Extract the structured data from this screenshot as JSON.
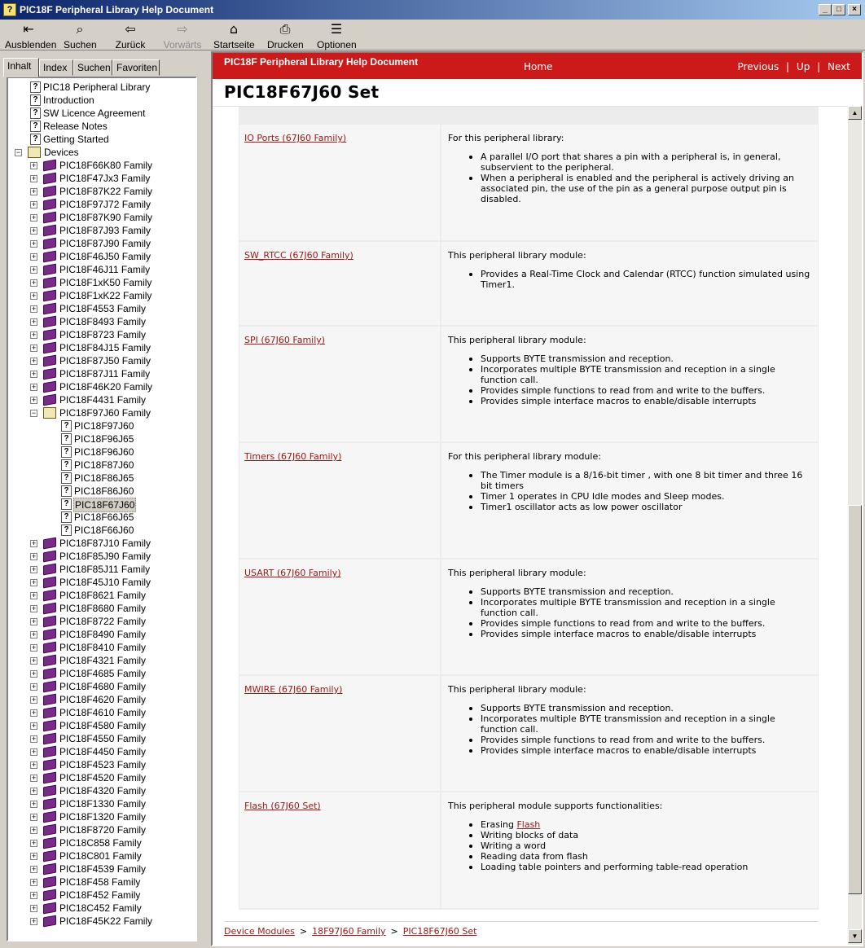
{
  "window": {
    "title": "PIC18F Peripheral Library Help Document"
  },
  "toolbar": [
    {
      "label": "Ausblenden",
      "icon": "hide-icon",
      "glyph": "⇤",
      "enabled": true
    },
    {
      "label": "Suchen",
      "icon": "search-icon",
      "glyph": "⌕",
      "enabled": true
    },
    {
      "label": "Zurück",
      "icon": "back-arrow-icon",
      "glyph": "⇦",
      "enabled": true
    },
    {
      "label": "Vorwärts",
      "icon": "forward-arrow-icon",
      "glyph": "⇨",
      "enabled": false
    },
    {
      "label": "Startseite",
      "icon": "home-icon",
      "glyph": "⌂",
      "enabled": true
    },
    {
      "label": "Drucken",
      "icon": "print-icon",
      "glyph": "⎙",
      "enabled": true
    },
    {
      "label": "Optionen",
      "icon": "options-icon",
      "glyph": "☰",
      "enabled": true
    }
  ],
  "tabs": [
    "Inhalt",
    "Index",
    "Suchen",
    "Favoriten"
  ],
  "tree": [
    {
      "label": "PIC18 Peripheral Library",
      "icon": "help-page",
      "level": 1
    },
    {
      "label": "Introduction",
      "icon": "help-page",
      "level": 1
    },
    {
      "label": "SW Licence Agreement",
      "icon": "help-page",
      "level": 1
    },
    {
      "label": "Release Notes",
      "icon": "help-page",
      "level": 1
    },
    {
      "label": "Getting Started",
      "icon": "help-page",
      "level": 1
    },
    {
      "label": "Devices",
      "icon": "open-book",
      "level": 0,
      "expander": "−"
    },
    {
      "label": "PIC18F66K80 Family",
      "icon": "book",
      "level": 1,
      "expander": "+"
    },
    {
      "label": "PIC18F47Jx3 Family",
      "icon": "book",
      "level": 1,
      "expander": "+"
    },
    {
      "label": "PIC18F87K22 Family",
      "icon": "book",
      "level": 1,
      "expander": "+"
    },
    {
      "label": "PIC18F97J72 Family",
      "icon": "book",
      "level": 1,
      "expander": "+"
    },
    {
      "label": "PIC18F87K90 Family",
      "icon": "book",
      "level": 1,
      "expander": "+"
    },
    {
      "label": "PIC18F87J93 Family",
      "icon": "book",
      "level": 1,
      "expander": "+"
    },
    {
      "label": "PIC18F87J90 Family",
      "icon": "book",
      "level": 1,
      "expander": "+"
    },
    {
      "label": "PIC18F46J50 Family",
      "icon": "book",
      "level": 1,
      "expander": "+"
    },
    {
      "label": "PIC18F46J11 Family",
      "icon": "book",
      "level": 1,
      "expander": "+"
    },
    {
      "label": "PIC18F1xK50 Family",
      "icon": "book",
      "level": 1,
      "expander": "+"
    },
    {
      "label": "PIC18F1xK22 Family",
      "icon": "book",
      "level": 1,
      "expander": "+"
    },
    {
      "label": "PIC18F4553 Family",
      "icon": "book",
      "level": 1,
      "expander": "+"
    },
    {
      "label": "PIC18F8493 Family",
      "icon": "book",
      "level": 1,
      "expander": "+"
    },
    {
      "label": "PIC18F8723 Family",
      "icon": "book",
      "level": 1,
      "expander": "+"
    },
    {
      "label": "PIC18F84J15 Family",
      "icon": "book",
      "level": 1,
      "expander": "+"
    },
    {
      "label": "PIC18F87J50 Family",
      "icon": "book",
      "level": 1,
      "expander": "+"
    },
    {
      "label": "PIC18F87J11 Family",
      "icon": "book",
      "level": 1,
      "expander": "+"
    },
    {
      "label": "PIC18F46K20 Family",
      "icon": "book",
      "level": 1,
      "expander": "+"
    },
    {
      "label": "PIC18F4431 Family",
      "icon": "book",
      "level": 1,
      "expander": "+"
    },
    {
      "label": "PIC18F97J60 Family",
      "icon": "open-book",
      "level": 1,
      "expander": "−"
    },
    {
      "label": "PIC18F97J60",
      "icon": "help-page",
      "level": 2
    },
    {
      "label": "PIC18F96J65",
      "icon": "help-page",
      "level": 2
    },
    {
      "label": "PIC18F96J60",
      "icon": "help-page",
      "level": 2
    },
    {
      "label": "PIC18F87J60",
      "icon": "help-page",
      "level": 2
    },
    {
      "label": "PIC18F86J65",
      "icon": "help-page",
      "level": 2
    },
    {
      "label": "PIC18F86J60",
      "icon": "help-page",
      "level": 2
    },
    {
      "label": "PIC18F67J60",
      "icon": "help-page",
      "level": 2,
      "selected": true
    },
    {
      "label": "PIC18F66J65",
      "icon": "help-page",
      "level": 2
    },
    {
      "label": "PIC18F66J60",
      "icon": "help-page",
      "level": 2
    },
    {
      "label": "PIC18F87J10 Family",
      "icon": "book",
      "level": 1,
      "expander": "+"
    },
    {
      "label": "PIC18F85J90 Family",
      "icon": "book",
      "level": 1,
      "expander": "+"
    },
    {
      "label": "PIC18F85J11 Family",
      "icon": "book",
      "level": 1,
      "expander": "+"
    },
    {
      "label": "PIC18F45J10 Family",
      "icon": "book",
      "level": 1,
      "expander": "+"
    },
    {
      "label": "PIC18F8621 Family",
      "icon": "book",
      "level": 1,
      "expander": "+"
    },
    {
      "label": "PIC18F8680 Family",
      "icon": "book",
      "level": 1,
      "expander": "+"
    },
    {
      "label": "PIC18F8722 Family",
      "icon": "book",
      "level": 1,
      "expander": "+"
    },
    {
      "label": "PIC18F8490 Family",
      "icon": "book",
      "level": 1,
      "expander": "+"
    },
    {
      "label": "PIC18F8410 Family",
      "icon": "book",
      "level": 1,
      "expander": "+"
    },
    {
      "label": "PIC18F4321 Family",
      "icon": "book",
      "level": 1,
      "expander": "+"
    },
    {
      "label": "PIC18F4685 Family",
      "icon": "book",
      "level": 1,
      "expander": "+"
    },
    {
      "label": "PIC18F4680 Family",
      "icon": "book",
      "level": 1,
      "expander": "+"
    },
    {
      "label": "PIC18F4620 Family",
      "icon": "book",
      "level": 1,
      "expander": "+"
    },
    {
      "label": "PIC18F4610 Family",
      "icon": "book",
      "level": 1,
      "expander": "+"
    },
    {
      "label": "PIC18F4580 Family",
      "icon": "book",
      "level": 1,
      "expander": "+"
    },
    {
      "label": "PIC18F4550 Family",
      "icon": "book",
      "level": 1,
      "expander": "+"
    },
    {
      "label": "PIC18F4450 Family",
      "icon": "book",
      "level": 1,
      "expander": "+"
    },
    {
      "label": "PIC18F4523 Family",
      "icon": "book",
      "level": 1,
      "expander": "+"
    },
    {
      "label": "PIC18F4520 Family",
      "icon": "book",
      "level": 1,
      "expander": "+"
    },
    {
      "label": "PIC18F4320 Family",
      "icon": "book",
      "level": 1,
      "expander": "+"
    },
    {
      "label": "PIC18F1330 Family",
      "icon": "book",
      "level": 1,
      "expander": "+"
    },
    {
      "label": "PIC18F1320 Family",
      "icon": "book",
      "level": 1,
      "expander": "+"
    },
    {
      "label": "PIC18F8720 Family",
      "icon": "book",
      "level": 1,
      "expander": "+"
    },
    {
      "label": "PIC18C858 Family",
      "icon": "book",
      "level": 1,
      "expander": "+"
    },
    {
      "label": "PIC18C801 Family",
      "icon": "book",
      "level": 1,
      "expander": "+"
    },
    {
      "label": "PIC18F4539 Family",
      "icon": "book",
      "level": 1,
      "expander": "+"
    },
    {
      "label": "PIC18F458 Family",
      "icon": "book",
      "level": 1,
      "expander": "+"
    },
    {
      "label": "PIC18F452 Family",
      "icon": "book",
      "level": 1,
      "expander": "+"
    },
    {
      "label": "PIC18C452 Family",
      "icon": "book",
      "level": 1,
      "expander": "+"
    },
    {
      "label": "PIC18F45K22 Family",
      "icon": "book",
      "level": 1,
      "expander": "+"
    }
  ],
  "header": {
    "doc_title": "PIC18F Peripheral Library Help Document",
    "home": "Home",
    "previous": "Previous",
    "up": "Up",
    "next": "Next",
    "separator": "|",
    "bar_color": "#cc1a1a"
  },
  "topic_title": "PIC18F67J60 Set",
  "rows": [
    {
      "link": "IO Ports (67J60 Family)",
      "intro": "For this peripheral library:",
      "bullets": [
        "A parallel I/O port that shares a pin with a peripheral is, in general, subservient to the peripheral.",
        "When a peripheral is enabled and the peripheral is actively driving an associated pin, the use of the pin as a general purpose output pin is disabled."
      ]
    },
    {
      "link": "SW_RTCC (67J60 Family)",
      "intro": "This peripheral library module:",
      "bullets": [
        "Provides a Real-Time Clock and Calendar (RTCC) function simulated using Timer1."
      ]
    },
    {
      "link": "SPI (67J60 Family)",
      "intro": "This peripheral library module:",
      "bullets": [
        "Supports BYTE transmission and reception.",
        "Incorporates multiple BYTE transmission and reception in a single function call.",
        "Provides simple functions to read from and write to the buffers.",
        "Provides simple interface macros to enable/disable interrupts"
      ]
    },
    {
      "link": "Timers (67J60 Family)",
      "intro": "For this peripheral library module:",
      "bullets": [
        "The Timer module is a 8/16-bit timer , with one 8 bit timer and three 16 bit timers",
        "Timer 1 operates in CPU Idle modes and Sleep modes.",
        "Timer1 oscillator acts as low power oscillator"
      ]
    },
    {
      "link": "USART (67J60 Family)",
      "intro": "This peripheral library module:",
      "bullets": [
        "Supports BYTE transmission and reception.",
        "Incorporates multiple BYTE transmission and reception in a single function call.",
        "Provides simple functions to read from and write to the buffers.",
        "Provides simple interface macros to enable/disable interrupts"
      ]
    },
    {
      "link": "MWIRE (67J60 Family)",
      "intro": "This peripheral library module:",
      "bullets": [
        "Supports BYTE transmission and reception.",
        "Incorporates multiple BYTE transmission and reception in a single function call.",
        "Provides simple functions to read from and write to the buffers.",
        "Provides simple interface macros to enable/disable interrupts"
      ]
    },
    {
      "link": "Flash (67J60 Set)",
      "intro": "This peripheral module supports functionalities:",
      "bullets": [
        {
          "prefix": "Erasing ",
          "link": "Flash"
        },
        "Writing blocks of data",
        "Writing a word",
        "Reading data from flash",
        "Loading table pointers and performing table-read operation"
      ]
    }
  ],
  "breadcrumb": {
    "items": [
      "Device Modules",
      "18F97J60 Family",
      "PIC18F67J60 Set"
    ],
    "separator": ">"
  },
  "colors": {
    "link": "#a01818",
    "accent": "#cc1a1a"
  }
}
